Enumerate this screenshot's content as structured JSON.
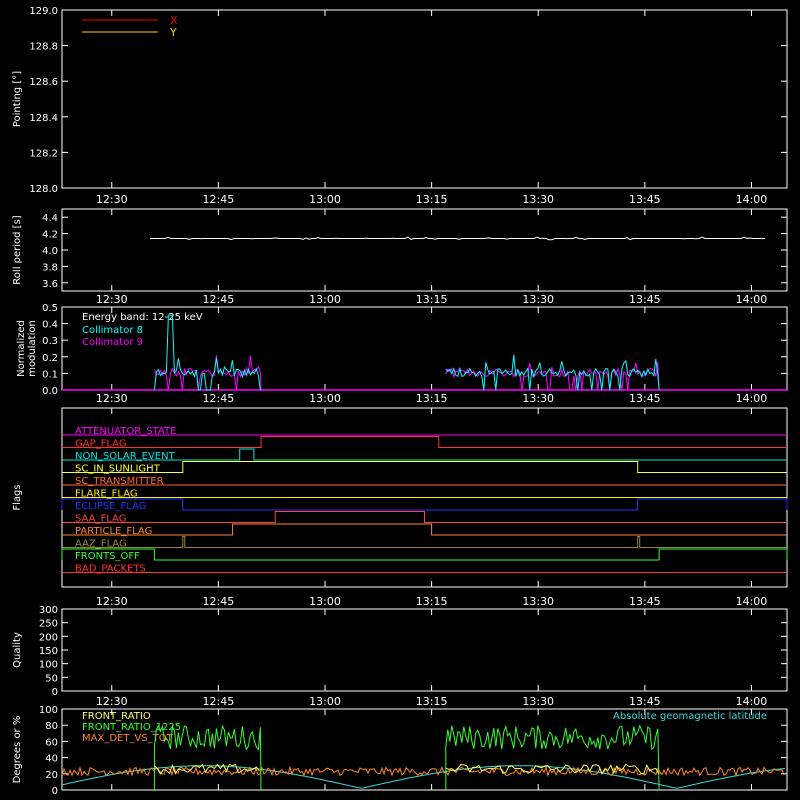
{
  "chart_data": [
    {
      "type": "line",
      "panel": "pointing",
      "ylabel": "Pointing [°]",
      "ylim": [
        128.0,
        129.0
      ],
      "yticks": [
        "128.0",
        "128.2",
        "128.4",
        "128.6",
        "128.8",
        "129.0"
      ],
      "xlim": [
        "12:23",
        "14:05"
      ],
      "xticks": [
        "12:30",
        "12:45",
        "13:00",
        "13:15",
        "13:30",
        "13:45",
        "14:00"
      ],
      "legend_position": "top-left",
      "series": [
        {
          "name": "X",
          "color": "#ff0000",
          "values": []
        },
        {
          "name": "Y",
          "color": "#ffcc00",
          "values": []
        }
      ]
    },
    {
      "type": "line",
      "panel": "roll",
      "ylabel": "Roll period [s]",
      "ylim": [
        3.5,
        4.5
      ],
      "yticks": [
        "3.6",
        "3.8",
        "4.0",
        "4.2",
        "4.4"
      ],
      "xticks": [
        "12:30",
        "12:45",
        "13:00",
        "13:15",
        "13:30",
        "13:45",
        "14:00"
      ],
      "series": [
        {
          "name": "",
          "color": "#ffffff",
          "value": 4.14
        }
      ]
    },
    {
      "type": "line",
      "panel": "modulation",
      "ylabel": "Normalized modulation",
      "ylim": [
        0,
        0.5
      ],
      "yticks": [
        "0.0",
        "0.1",
        "0.2",
        "0.3",
        "0.4",
        "0.5"
      ],
      "xticks": [
        "12:30",
        "12:45",
        "13:00",
        "13:15",
        "13:30",
        "13:45",
        "14:00"
      ],
      "annotation": "Energy band: 12-25 keV",
      "active_windows": [
        [
          "12:36",
          "12:51"
        ],
        [
          "13:17",
          "13:47"
        ]
      ],
      "series": [
        {
          "name": "Collimator 8",
          "color": "#00ffff"
        },
        {
          "name": "Collimator 9",
          "color": "#ff00ff"
        }
      ]
    },
    {
      "type": "line",
      "panel": "flags",
      "ylabel": "Flags",
      "xticks": [
        "12:30",
        "12:45",
        "13:00",
        "13:15",
        "13:30",
        "13:45",
        "14:00"
      ],
      "series": [
        {
          "name": "ATTENUATOR_STATE",
          "color": "#ff00ff",
          "highs": []
        },
        {
          "name": "GAP_FLAG",
          "color": "#ff3333",
          "highs": [
            [
              "12:51",
              "13:16"
            ]
          ]
        },
        {
          "name": "NON_SOLAR_EVENT",
          "color": "#00e5e5",
          "highs": [
            [
              "12:48",
              "12:50"
            ]
          ]
        },
        {
          "name": "SC_IN_SUNLIGHT",
          "color": "#ffff33",
          "highs": [
            [
              "12:40",
              "13:44"
            ]
          ]
        },
        {
          "name": "SC_TRANSMITTER",
          "color": "#ff6633",
          "highs": []
        },
        {
          "name": "FLARE_FLAG",
          "color": "#ffee00",
          "highs": []
        },
        {
          "name": "ECLIPSE_FLAG",
          "color": "#2233ff",
          "highs": [
            [
              "12:23",
              "12:40"
            ],
            [
              "13:44",
              "14:05"
            ]
          ]
        },
        {
          "name": "SAA_FLAG",
          "color": "#ff4444",
          "highs": [
            [
              "12:53",
              "13:14"
            ]
          ]
        },
        {
          "name": "PARTICLE_FLAG",
          "color": "#ff8833",
          "highs": [
            [
              "12:47",
              "13:15"
            ]
          ]
        },
        {
          "name": "AAZ_FLAG",
          "color": "#998833",
          "highs": [
            [
              "12:40",
              "12:40"
            ],
            [
              "13:44",
              "13:44"
            ]
          ]
        },
        {
          "name": "FRONTS_OFF",
          "color": "#33ff33",
          "highs": [
            [
              "12:23",
              "12:36"
            ],
            [
              "13:47",
              "14:05"
            ]
          ]
        },
        {
          "name": "BAD_PACKETS",
          "color": "#ff3333",
          "highs": []
        }
      ]
    },
    {
      "type": "line",
      "panel": "quality",
      "ylabel": "Quality",
      "ylim": [
        0,
        300
      ],
      "yticks": [
        "0",
        "50",
        "100",
        "150",
        "200",
        "250",
        "300"
      ],
      "xticks": [
        "12:30",
        "12:45",
        "13:00",
        "13:15",
        "13:30",
        "13:45",
        "14:00"
      ],
      "series": []
    },
    {
      "type": "line",
      "panel": "ratios",
      "ylabel": "Degrees or %",
      "ylim": [
        0,
        100
      ],
      "yticks": [
        "0",
        "20",
        "40",
        "60",
        "80",
        "100"
      ],
      "annotation": "Absolute geomagnetic latitude",
      "series": [
        {
          "name": "FRONT_RATIO",
          "color": "#ffff66"
        },
        {
          "name": "FRONT_RATIO_1225",
          "color": "#33ff33"
        },
        {
          "name": "MAX_DET_VS_TOT",
          "color": "#ff8822"
        }
      ],
      "annotation_color": "#33dddd"
    }
  ]
}
